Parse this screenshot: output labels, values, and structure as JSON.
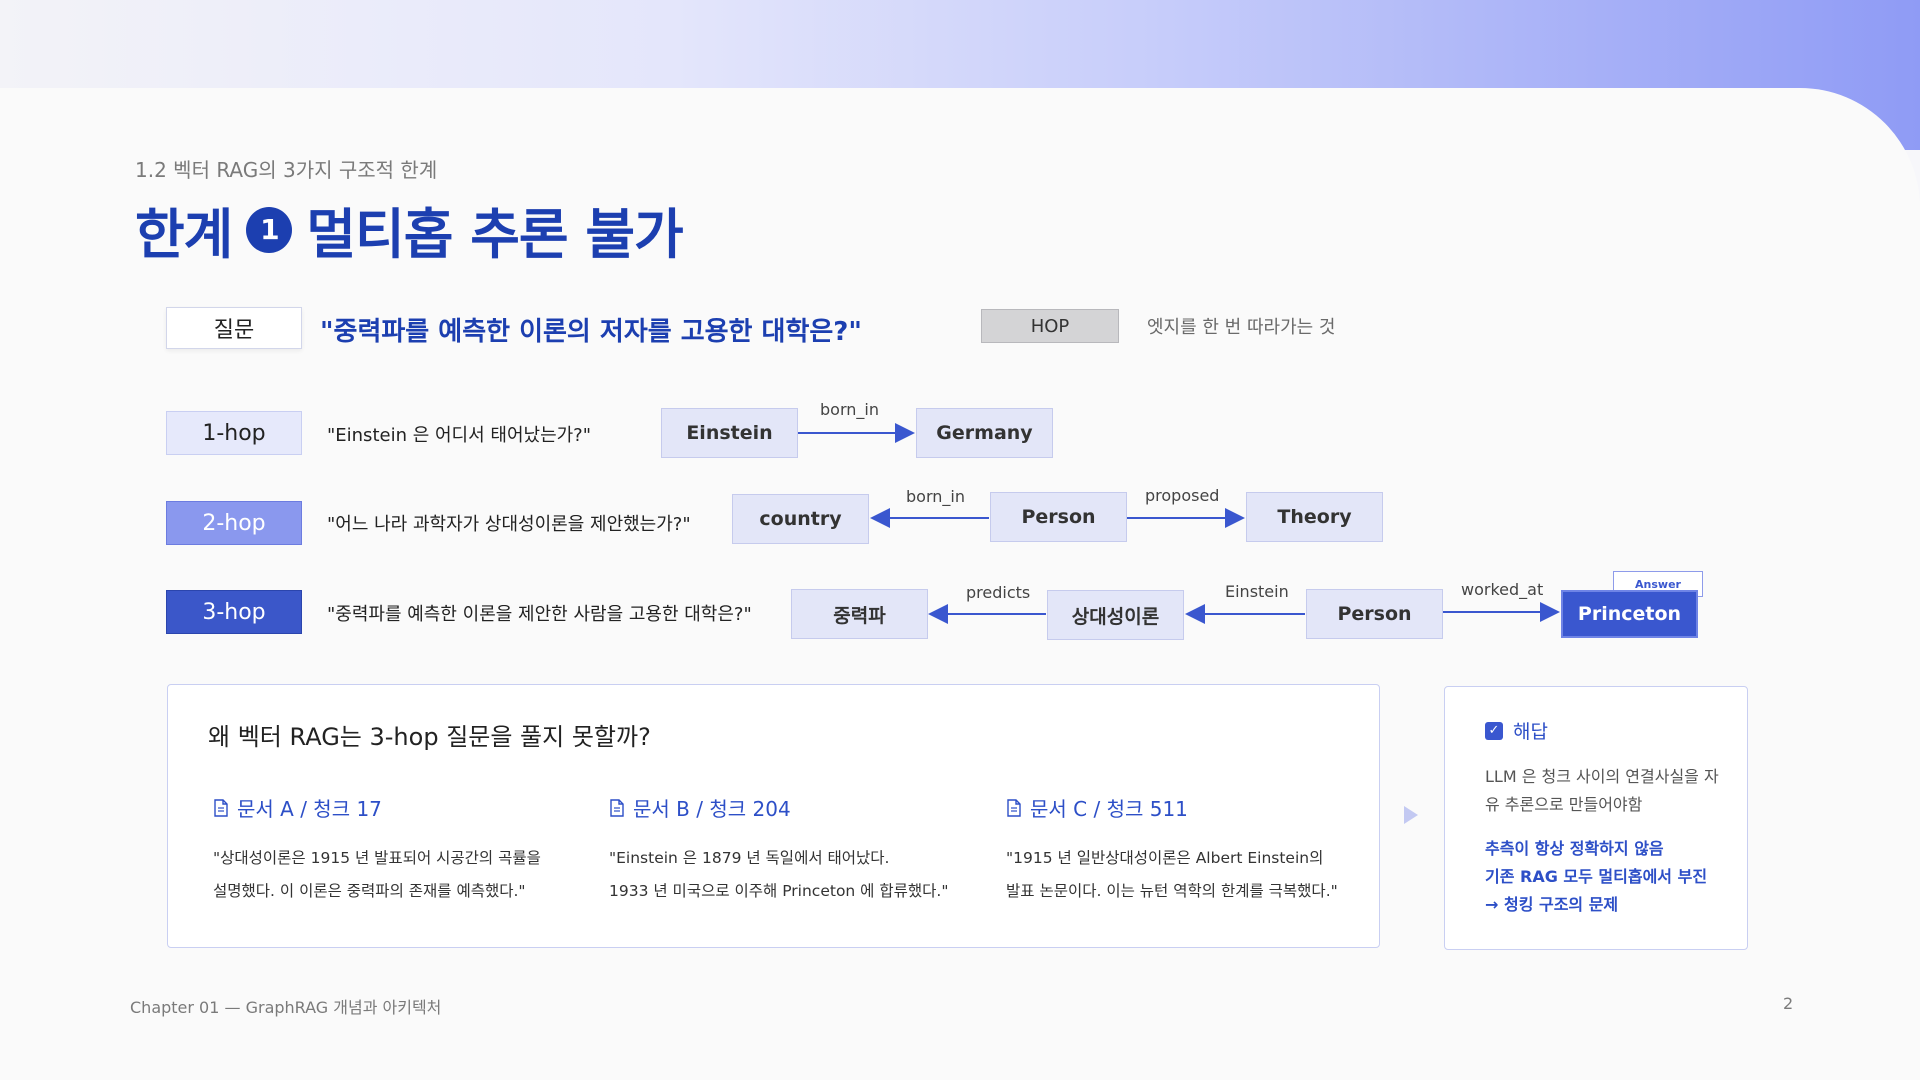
{
  "breadcrumb": "1.2 벡터 RAG의 3가지 구조적 한계",
  "title": {
    "prefix": "한계",
    "number": "1",
    "text": "멀티홉 추론 불가"
  },
  "question": {
    "label": "질문",
    "text": "\"중력파를 예측한 이론의 저자를 고용한 대학은?\""
  },
  "hop_def": {
    "label": "HOP",
    "desc": "엣지를 한 번 따라가는 것"
  },
  "hops": [
    {
      "label": "1-hop",
      "question": "\"Einstein 은 어디서 태어났는가?\""
    },
    {
      "label": "2-hop",
      "question": "\"어느 나라 과학자가 상대성이론을 제안했는가?\""
    },
    {
      "label": "3-hop",
      "question": "\"중력파를 예측한 이론을 제안한 사람을 고용한 대학은?\""
    }
  ],
  "graph": {
    "row1": {
      "nodes": [
        "Einstein",
        "Germany"
      ],
      "edges": [
        "born_in"
      ]
    },
    "row2": {
      "nodes": [
        "country",
        "Person",
        "Theory"
      ],
      "edges": [
        "born_in",
        "proposed"
      ]
    },
    "row3": {
      "nodes": [
        "중력파",
        "상대성이론",
        "Person",
        "Princeton"
      ],
      "edges": [
        "predicts",
        "Einstein",
        "worked_at"
      ],
      "answer_badge": "Answer"
    }
  },
  "panel": {
    "title": "왜 벡터 RAG는 3-hop 질문을 풀지 못할까?",
    "docs": [
      {
        "title": "문서 A / 청크 17",
        "line1": "\"상대성이론은 1915 년 발표되어 시공간의 곡률을",
        "line2": "설명했다. 이 이론은 중력파의 존재를 예측했다.\""
      },
      {
        "title": "문서 B / 청크 204",
        "line1": "\"Einstein 은 1879 년 독일에서 태어났다.",
        "line2": "1933 년 미국으로 이주해 Princeton 에 합류했다.\""
      },
      {
        "title": "문서 C / 청크 511",
        "line1": "\"1915 년 일반상대성이론은 Albert Einstein의",
        "line2": "발표 논문이다. 이는 뉴턴 역학의 한계를 극복했다.\""
      }
    ]
  },
  "answer": {
    "heading": "해답",
    "body": "LLM 은 청크 사이의 연결사실을 자유 추론으로 만들어야함",
    "strong1": "추측이 항상 정확하지 않음",
    "strong2": "기존 RAG 모두 멀티홉에서 부진",
    "strong3": "→ 청킹 구조의 문제"
  },
  "footer": "Chapter 01 — GraphRAG 개념과 아키텍처",
  "page_number": "2",
  "colors": {
    "accent": "#1c3fb0",
    "node_bg": "#e3e6f8",
    "answer_node": "#3a57cf"
  }
}
